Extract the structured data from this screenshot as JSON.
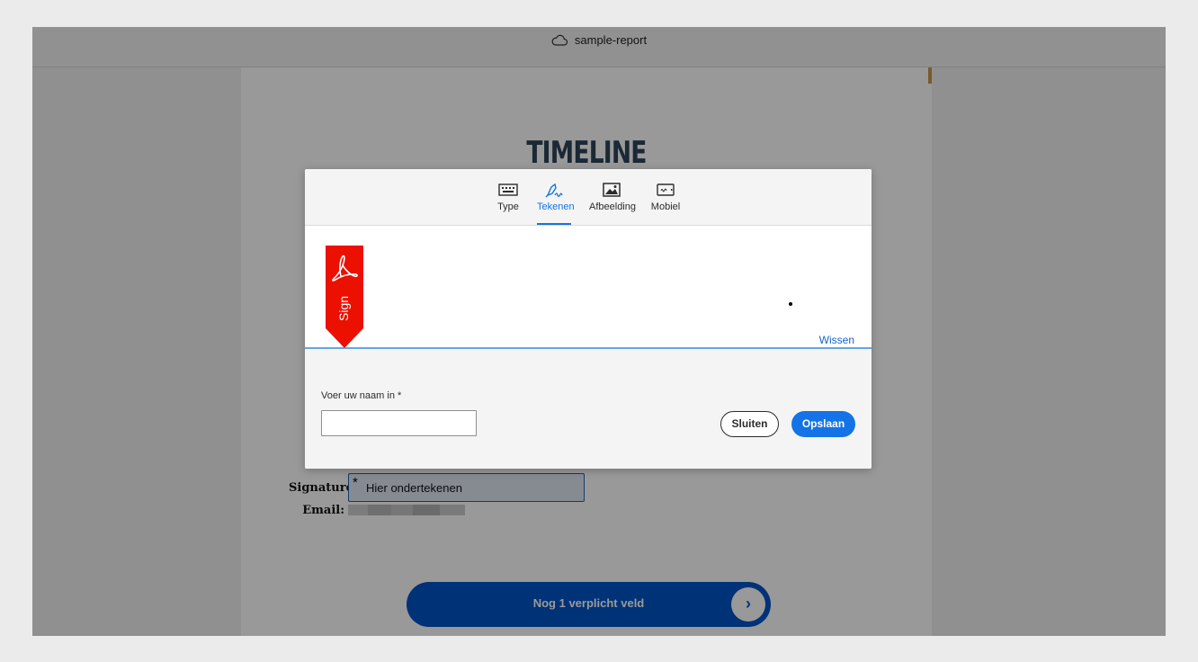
{
  "header": {
    "doc_name": "sample-report",
    "icon": "cloud-icon"
  },
  "document": {
    "heading": "TIMELINE",
    "signature_label": "Signature:",
    "signature_field_required_mark": "*",
    "signature_field_text": "Hier ondertekenen",
    "email_label": "Email:",
    "next_button_label": "Nog 1 verplicht veld",
    "next_button_icon": "chevron-right-icon"
  },
  "modal": {
    "tabs": [
      {
        "label": "Type",
        "icon": "keyboard-icon",
        "active": false
      },
      {
        "label": "Tekenen",
        "icon": "draw-pen-icon",
        "active": true
      },
      {
        "label": "Afbeelding",
        "icon": "image-icon",
        "active": false
      },
      {
        "label": "Mobiel",
        "icon": "mobile-icon",
        "active": false
      }
    ],
    "sign_ribbon_text": "Sign",
    "clear_link": "Wissen",
    "name_label": "Voer uw naam in",
    "name_required_mark": "*",
    "name_value": "",
    "close_button": "Sluiten",
    "save_button": "Opslaan"
  },
  "colors": {
    "accent": "#1473e6",
    "next_button": "#0154c8",
    "ribbon_red": "#eb1000",
    "heading": "#2e4459"
  }
}
